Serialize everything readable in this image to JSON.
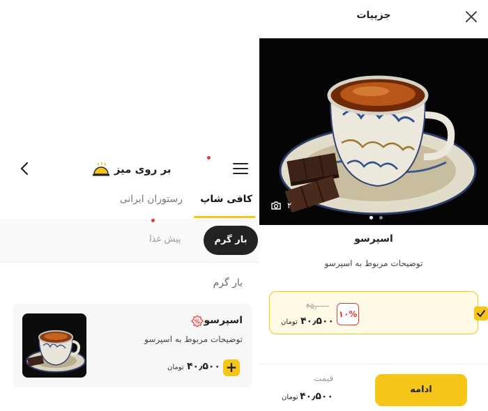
{
  "colors": {
    "accent": "#f5c518",
    "dark": "#222222",
    "discount": "#e53935"
  },
  "menu_page": {
    "brand": "بر روی میز",
    "tabs": [
      {
        "label": "کافی شاپ",
        "active": true
      },
      {
        "label": "رستوران ایرانی",
        "active": false
      }
    ],
    "chips": [
      {
        "label": "بار گرم",
        "active": true
      },
      {
        "label": "پیش غذا",
        "active": false
      }
    ],
    "section_title": "بار گرم",
    "item": {
      "name": "اسپرسو",
      "description": "توضیحات مربوط به اسپرسو",
      "price": "۴۰٫۵۰۰",
      "currency": "تومان",
      "add_label": "+"
    }
  },
  "details_page": {
    "title": "جزییات",
    "photo_count": "۲",
    "product_name": "اسپرسو",
    "product_description": "توضیحات مربوط به اسپرسو",
    "option": {
      "old_price": "۴۵٫۰۰۰",
      "discount": "۱۰%",
      "price": "۴۰٫۵۰۰",
      "currency": "تومان",
      "selected": true
    },
    "footer": {
      "price_label": "قیمت",
      "price": "۴۰٫۵۰۰",
      "currency": "تومان",
      "continue_label": "ادامه"
    }
  }
}
